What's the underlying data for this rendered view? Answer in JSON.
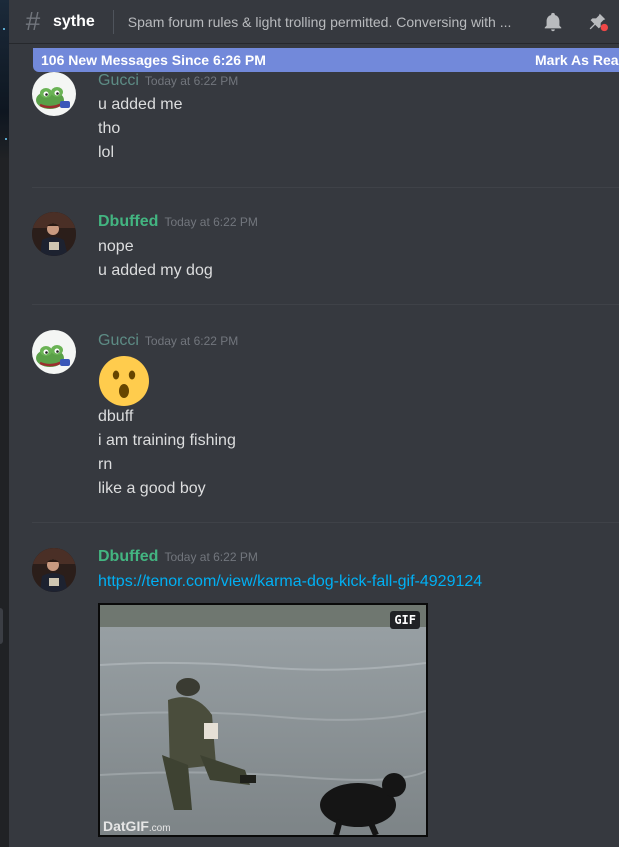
{
  "header": {
    "channel_name": "sythe",
    "topic": "Spam forum rules & light trolling permitted. Conversing with ..."
  },
  "new_messages_bar": {
    "label": "106 New Messages Since 6:26 PM",
    "action": "Mark As Read"
  },
  "messages": [
    {
      "author": "Gucci",
      "timestamp": "Today at 6:22 PM",
      "lines": [
        "u added me",
        "tho",
        "lol"
      ]
    },
    {
      "author": "Dbuffed",
      "timestamp": "Today at 6:22 PM",
      "lines": [
        "nope",
        "u added my dog"
      ]
    },
    {
      "author": "Gucci",
      "timestamp": "Today at 6:22 PM",
      "emoji": "open-mouth-emoji",
      "lines": [
        "dbuff",
        "i am training fishing",
        "rn",
        "like a good boy"
      ]
    },
    {
      "author": "Dbuffed",
      "timestamp": "Today at 6:22 PM",
      "link": "https://tenor.com/view/karma-dog-kick-fall-gif-4929124",
      "embed": {
        "badge": "GIF",
        "watermark": "DatGIF",
        "watermark_suffix": ".com"
      }
    }
  ],
  "colors": {
    "background": "#36393f",
    "accent_bar": "#7289da",
    "gucci_name": "#5d8c85",
    "dbuffed_name": "#43b581",
    "link": "#00b0f4"
  },
  "icons": [
    "hash-icon",
    "bell-icon",
    "pin-icon"
  ]
}
